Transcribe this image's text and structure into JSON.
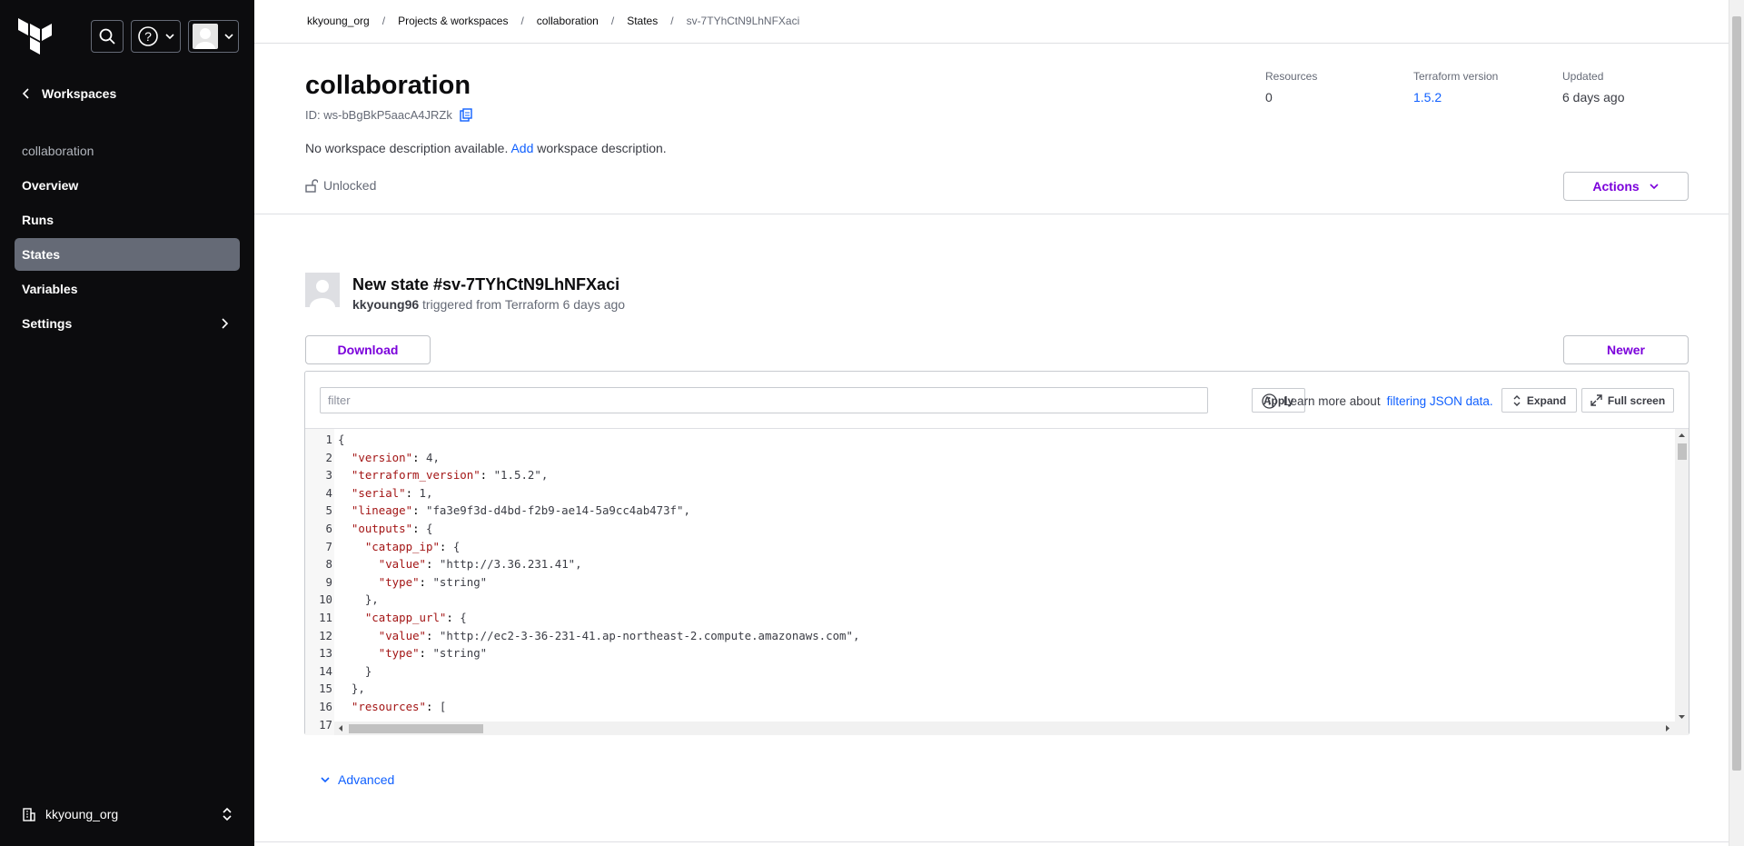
{
  "sidebar": {
    "back_label": "Workspaces",
    "workspace_name": "collaboration",
    "items": [
      {
        "label": "Overview"
      },
      {
        "label": "Runs"
      },
      {
        "label": "States"
      },
      {
        "label": "Variables"
      },
      {
        "label": "Settings"
      }
    ],
    "org_label": "kkyoung_org"
  },
  "breadcrumb": {
    "items": [
      "kkyoung_org",
      "Projects & workspaces",
      "collaboration",
      "States",
      "sv-7TYhCtN9LhNFXaci"
    ],
    "separator": "/"
  },
  "header": {
    "title": "collaboration",
    "id_label": "ID: ws-bBgBkP5aacA4JRZk",
    "desc_prefix": "No workspace description available.",
    "desc_link": "Add",
    "desc_suffix": "workspace description.",
    "lock_label": "Unlocked",
    "actions_label": "Actions",
    "meta": [
      {
        "label": "Resources",
        "value": "0"
      },
      {
        "label": "Terraform version",
        "value": "1.5.2"
      },
      {
        "label": "Updated",
        "value": "6 days ago"
      }
    ]
  },
  "state": {
    "title": "New state #sv-7TYhCtN9LhNFXaci",
    "user": "kkyoung96",
    "trigger_text": "triggered from Terraform 6 days ago",
    "download_label": "Download",
    "newer_label": "Newer"
  },
  "viewer": {
    "filter_placeholder": "filter",
    "apply_label": "Apply",
    "learn_prefix": "Learn more about",
    "learn_link": "filtering JSON data.",
    "expand_label": "Expand",
    "fullscreen_label": "Full screen",
    "lines": [
      "{",
      "  \"version\": 4,",
      "  \"terraform_version\": \"1.5.2\",",
      "  \"serial\": 1,",
      "  \"lineage\": \"fa3e9f3d-d4bd-f2b9-ae14-5a9cc4ab473f\",",
      "  \"outputs\": {",
      "    \"catapp_ip\": {",
      "      \"value\": \"http://3.36.231.41\",",
      "      \"type\": \"string\"",
      "    },",
      "    \"catapp_url\": {",
      "      \"value\": \"http://ec2-3-36-231-41.ap-northeast-2.compute.amazonaws.com\",",
      "      \"type\": \"string\"",
      "    }",
      "  },",
      "  \"resources\": [",
      ""
    ]
  },
  "advanced_label": "Advanced",
  "colors": {
    "sidebar_bg": "#0c0c0e",
    "active_nav": "#656a76",
    "accent_purple": "#7b00db",
    "link_blue": "#1060ff",
    "json_key": "#a31515",
    "json_number": "#098658"
  }
}
